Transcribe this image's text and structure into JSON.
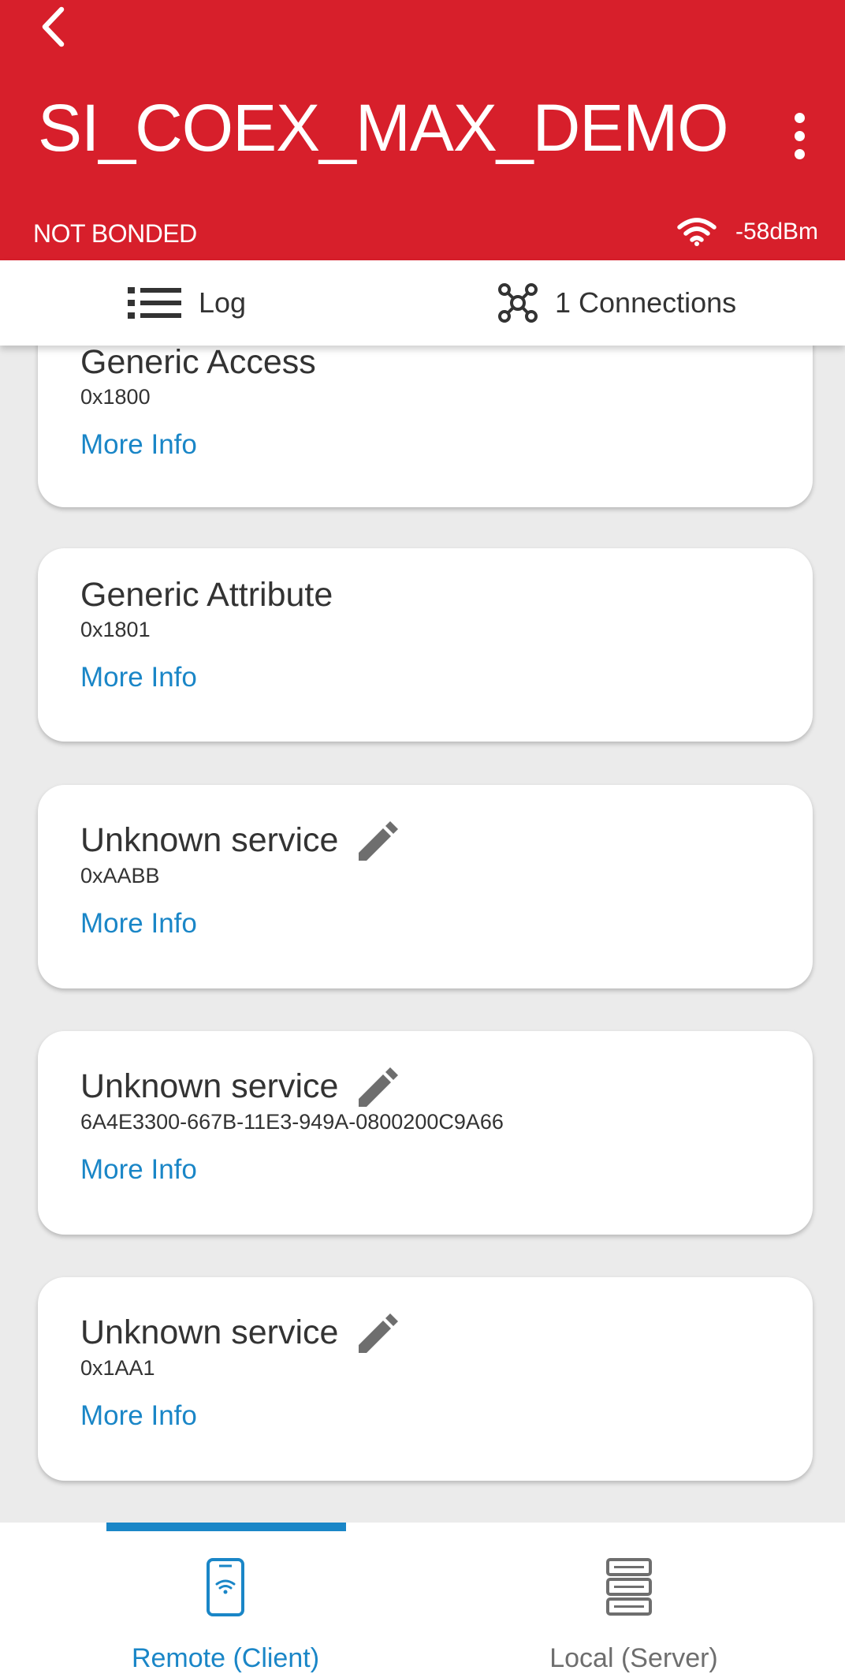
{
  "header": {
    "title": "SI_COEX_MAX_DEMO",
    "back_icon": "chevron-left-icon",
    "menu_icon": "more-vertical-icon",
    "bond_status": "NOT BONDED",
    "rssi": "-58dBm",
    "rssi_icon": "wifi-signal-icon"
  },
  "toolbar": {
    "log_label": "Log",
    "log_icon": "list-icon",
    "connections_label": "1 Connections",
    "connections_icon": "network-nodes-icon"
  },
  "services": [
    {
      "name": "Generic Access",
      "uuid": "0x1800",
      "link": "More Info",
      "editable": false
    },
    {
      "name": "Generic Attribute",
      "uuid": "0x1801",
      "link": "More Info",
      "editable": false
    },
    {
      "name": "Unknown service",
      "uuid": "0xAABB",
      "link": "More Info",
      "editable": true
    },
    {
      "name": "Unknown service",
      "uuid": "6A4E3300-667B-11E3-949A-0800200C9A66",
      "link": "More Info",
      "editable": true
    },
    {
      "name": "Unknown service",
      "uuid": "0x1AA1",
      "link": "More Info",
      "editable": true
    }
  ],
  "bottom_nav": {
    "remote_label": "Remote (Client)",
    "remote_icon": "phone-wifi-icon",
    "local_label": "Local (Server)",
    "local_icon": "server-icon",
    "active": "remote"
  },
  "colors": {
    "header_red": "#d71f2b",
    "accent_blue": "#1a86c7",
    "text_dark": "#333333",
    "background_gray": "#ebebeb"
  }
}
